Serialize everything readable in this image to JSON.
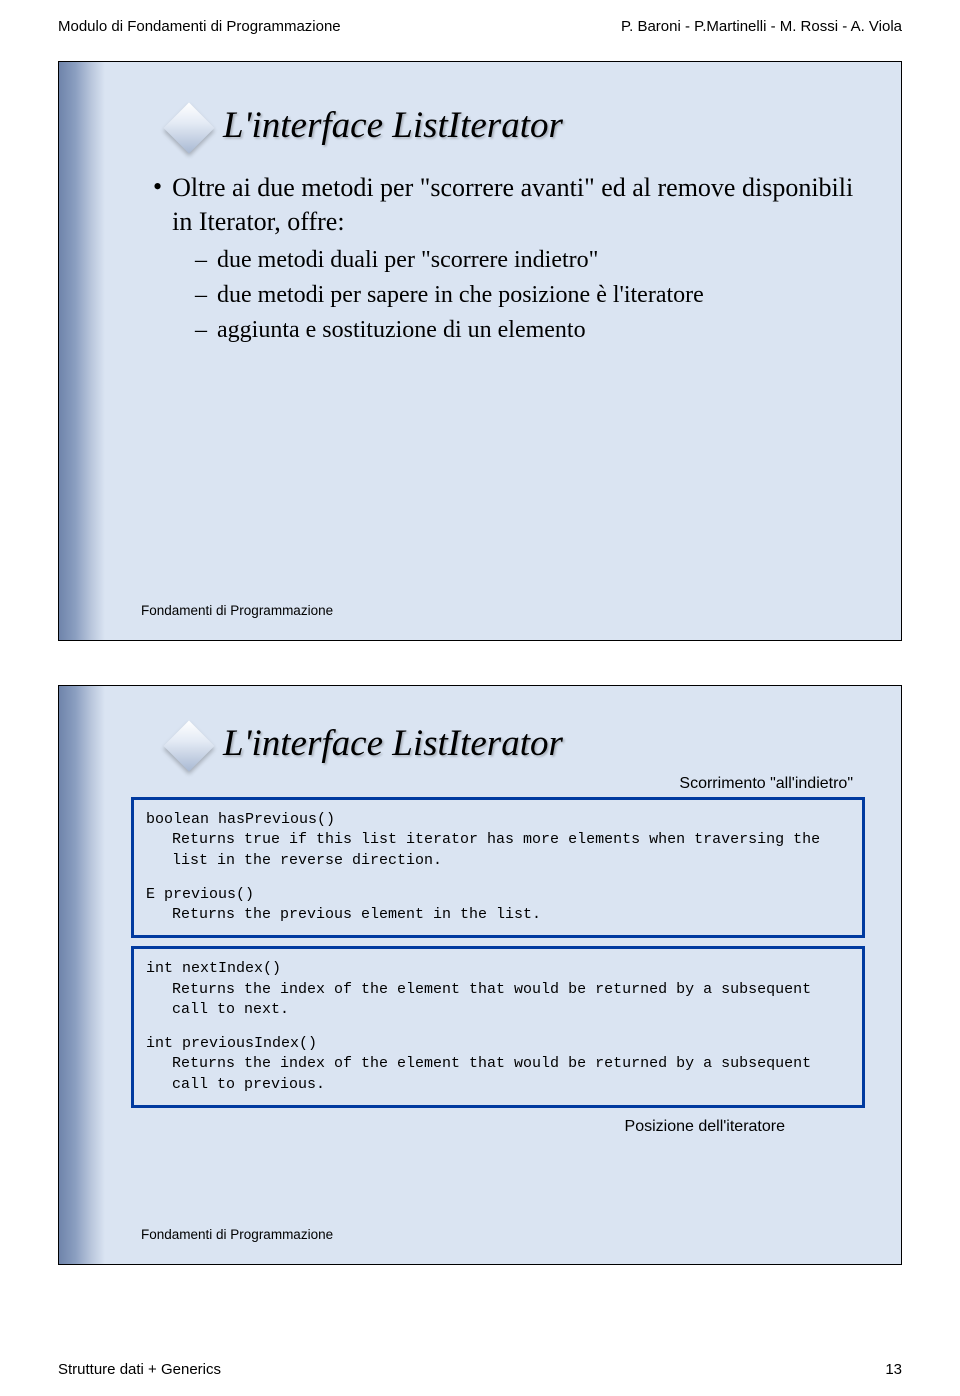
{
  "header": {
    "left": "Modulo di Fondamenti di Programmazione",
    "right": "P. Baroni - P.Martinelli - M. Rossi - A. Viola"
  },
  "slide1": {
    "title": "L'interface ListIterator",
    "b1": "Oltre ai due metodi per \"scorrere avanti\" ed al remove disponibili in Iterator, offre:",
    "b2a": "due metodi duali per \"scorrere indietro\"",
    "b2b": "due metodi per sapere in che posizione è l'iteratore",
    "b2c": "aggiunta e sostituzione di un elemento",
    "foot": "Fondamenti di Programmazione"
  },
  "slide2": {
    "title": "L'interface ListIterator",
    "tag1": "Scorrimento \"all'indietro\"",
    "tag2": "Posizione dell'iteratore",
    "box1": {
      "l1": "boolean hasPrevious()",
      "l2": "Returns true if this list iterator has more elements when traversing the list in the reverse direction.",
      "l3": "E previous()",
      "l4": "Returns the previous element in the list."
    },
    "box2": {
      "l1": "int nextIndex()",
      "l2": "Returns the index of the element that would be returned by a subsequent call to next.",
      "l3": "int previousIndex()",
      "l4": "Returns the index of the element that would be returned by a subsequent call to previous."
    },
    "foot": "Fondamenti di Programmazione"
  },
  "footer": {
    "left": "Strutture dati + Generics",
    "right": "13"
  }
}
